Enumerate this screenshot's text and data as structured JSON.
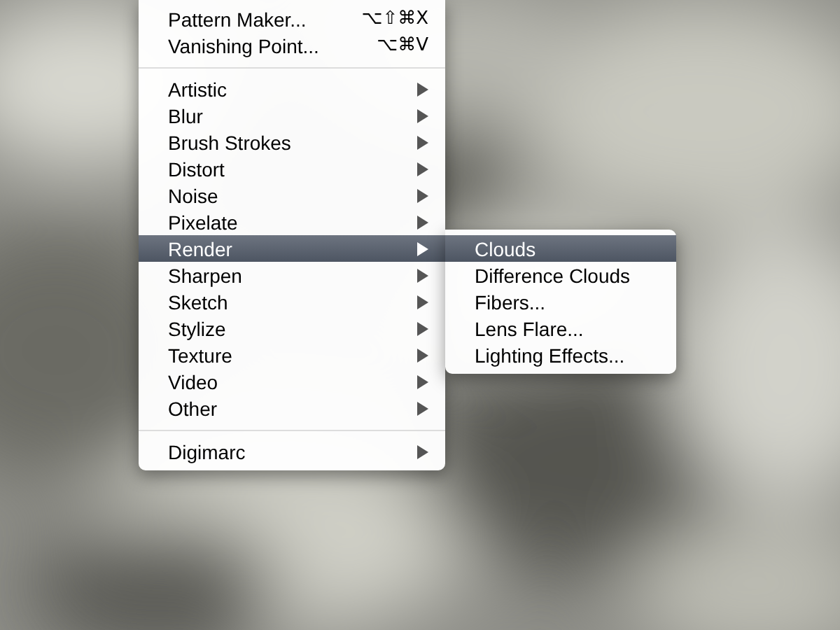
{
  "menu": {
    "items": [
      {
        "kind": "item",
        "label": "Pattern Maker...",
        "shortcut": "⌥⇧⌘X",
        "submenu": false,
        "selected": false
      },
      {
        "kind": "item",
        "label": "Vanishing Point...",
        "shortcut": "⌥⌘V",
        "submenu": false,
        "selected": false
      },
      {
        "kind": "separator"
      },
      {
        "kind": "item",
        "label": "Artistic",
        "submenu": true,
        "selected": false
      },
      {
        "kind": "item",
        "label": "Blur",
        "submenu": true,
        "selected": false
      },
      {
        "kind": "item",
        "label": "Brush Strokes",
        "submenu": true,
        "selected": false
      },
      {
        "kind": "item",
        "label": "Distort",
        "submenu": true,
        "selected": false
      },
      {
        "kind": "item",
        "label": "Noise",
        "submenu": true,
        "selected": false
      },
      {
        "kind": "item",
        "label": "Pixelate",
        "submenu": true,
        "selected": false
      },
      {
        "kind": "item",
        "label": "Render",
        "submenu": true,
        "selected": true
      },
      {
        "kind": "item",
        "label": "Sharpen",
        "submenu": true,
        "selected": false
      },
      {
        "kind": "item",
        "label": "Sketch",
        "submenu": true,
        "selected": false
      },
      {
        "kind": "item",
        "label": "Stylize",
        "submenu": true,
        "selected": false
      },
      {
        "kind": "item",
        "label": "Texture",
        "submenu": true,
        "selected": false
      },
      {
        "kind": "item",
        "label": "Video",
        "submenu": true,
        "selected": false
      },
      {
        "kind": "item",
        "label": "Other",
        "submenu": true,
        "selected": false
      },
      {
        "kind": "separator"
      },
      {
        "kind": "item",
        "label": "Digimarc",
        "submenu": true,
        "selected": false
      }
    ]
  },
  "submenu": {
    "items": [
      {
        "label": "Clouds",
        "selected": true
      },
      {
        "label": "Difference Clouds",
        "selected": false
      },
      {
        "label": "Fibers...",
        "selected": false
      },
      {
        "label": "Lens Flare...",
        "selected": false
      },
      {
        "label": "Lighting Effects...",
        "selected": false
      }
    ]
  }
}
